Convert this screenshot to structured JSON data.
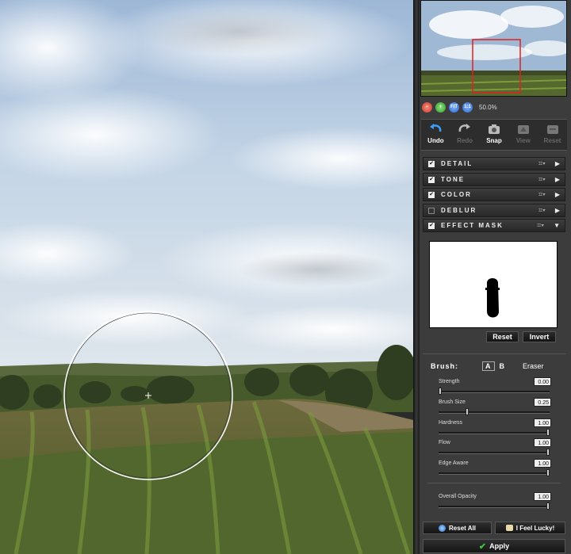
{
  "zoom": {
    "value": "50.0%",
    "buttons": [
      "zoom-out",
      "zoom-in",
      "FIT",
      "1:1"
    ]
  },
  "toolbar": [
    {
      "label": "Undo",
      "icon": "undo-icon",
      "enabled": true
    },
    {
      "label": "Redo",
      "icon": "redo-icon",
      "enabled": false
    },
    {
      "label": "Snap",
      "icon": "camera-icon",
      "enabled": true
    },
    {
      "label": "View",
      "icon": "view-icon",
      "enabled": false
    },
    {
      "label": "Reset",
      "icon": "reset-icon",
      "enabled": false
    }
  ],
  "sections": [
    {
      "title": "DETAIL",
      "checked": true,
      "expanded": false
    },
    {
      "title": "TONE",
      "checked": true,
      "expanded": false
    },
    {
      "title": "COLOR",
      "checked": true,
      "expanded": false
    },
    {
      "title": "DEBLUR",
      "checked": false,
      "expanded": false
    },
    {
      "title": "EFFECT MASK",
      "checked": true,
      "expanded": true
    }
  ],
  "mask": {
    "reset_label": "Reset",
    "invert_label": "Invert"
  },
  "brush": {
    "label": "Brush:",
    "mode_a": "A",
    "mode_b": "B",
    "eraser_label": "Eraser",
    "sliders": [
      {
        "label": "Strength",
        "value": "0.00",
        "level": 0.0
      },
      {
        "label": "Brush Size",
        "value": "0.25",
        "level": 0.25
      },
      {
        "label": "Hardness",
        "value": "1.00",
        "level": 1.0
      },
      {
        "label": "Flow",
        "value": "1.00",
        "level": 1.0
      },
      {
        "label": "Edge Aware",
        "value": "1.00",
        "level": 1.0
      }
    ],
    "opacity": {
      "label": "Overall Opacity",
      "value": "1.00",
      "level": 1.0
    }
  },
  "footer": {
    "reset_all": "Reset All",
    "lucky": "I Feel Lucky!",
    "apply": "Apply"
  },
  "colors": {
    "panel": "#3c3c3c",
    "navigator_box": "#e02020",
    "apply_check": "#3fbf3f"
  }
}
